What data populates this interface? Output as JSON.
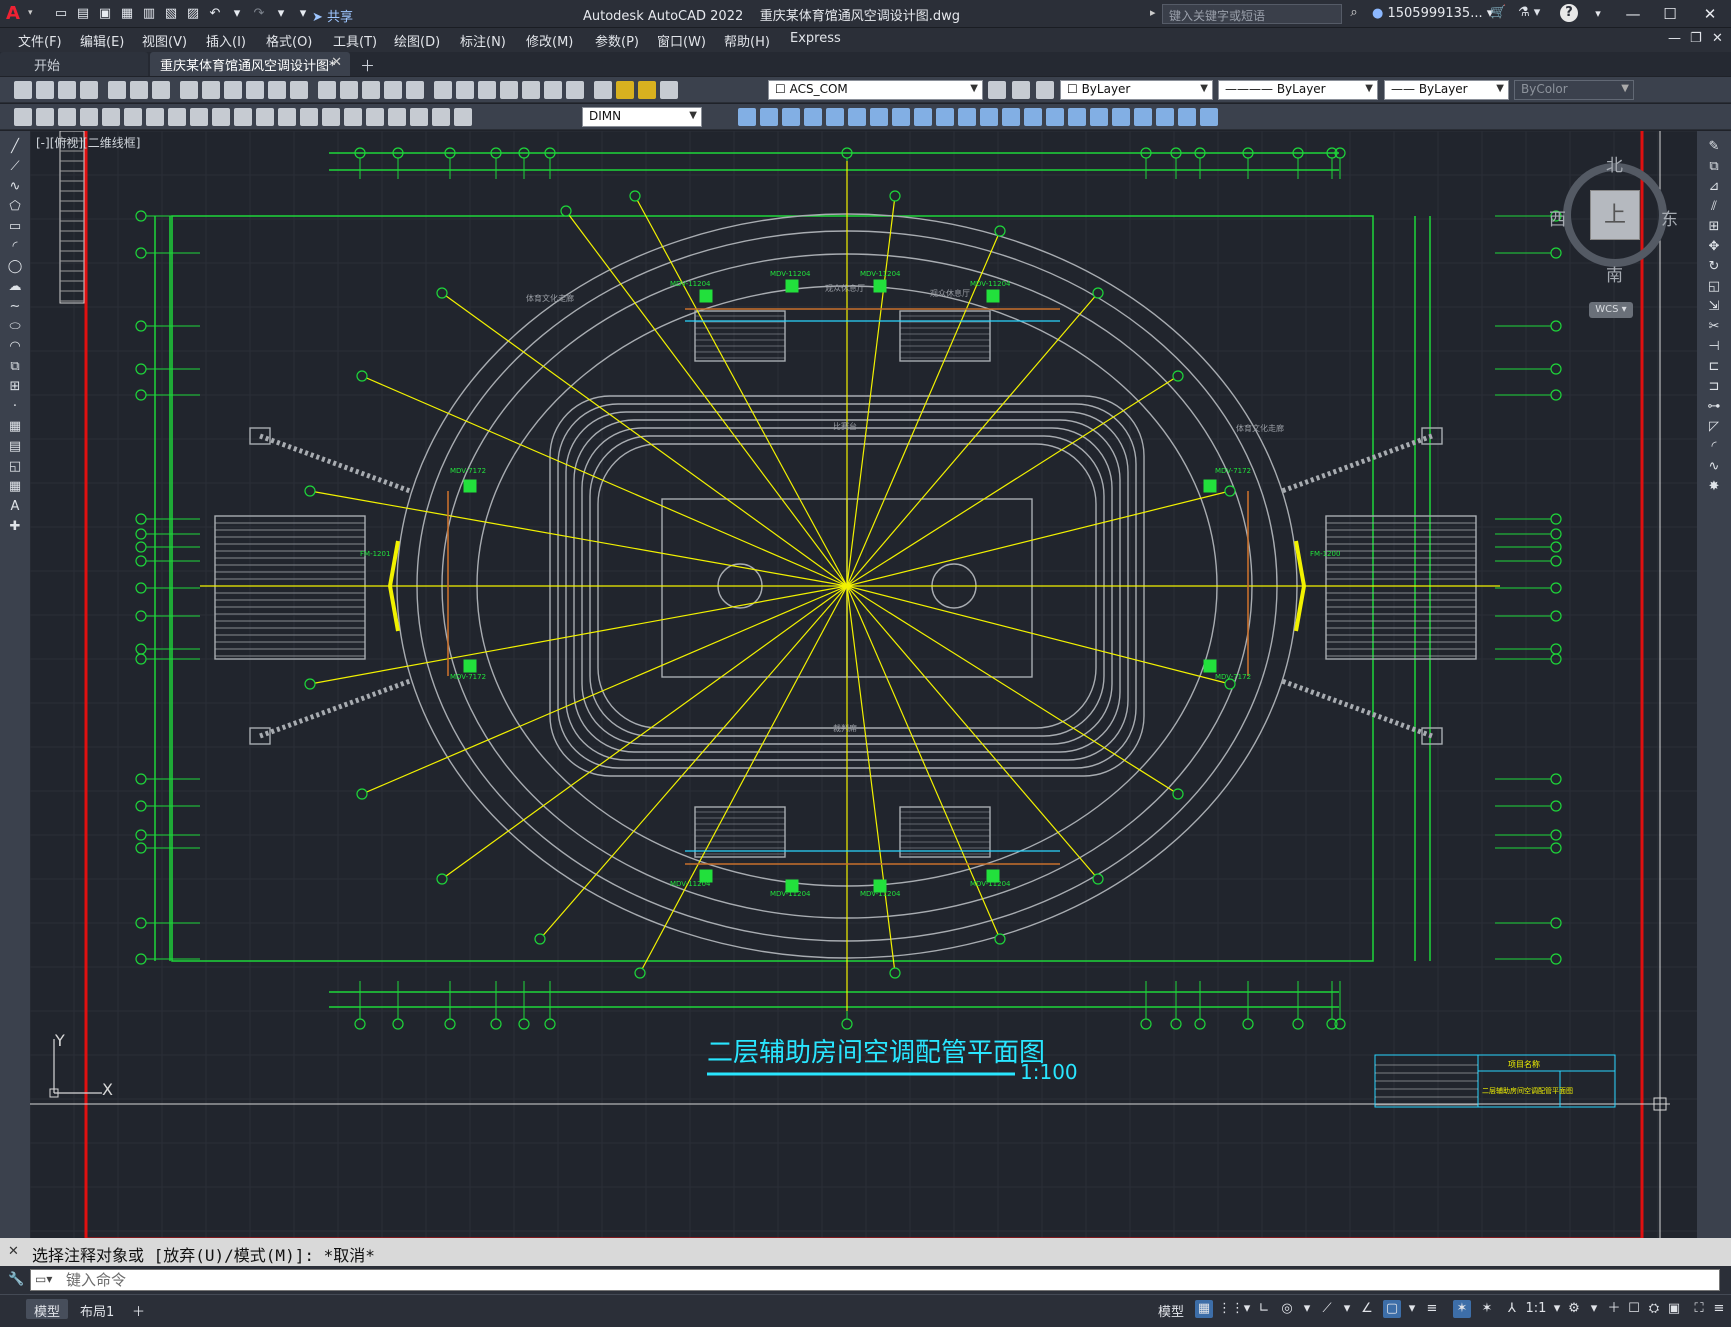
{
  "titlebar": {
    "app_name": "Autodesk AutoCAD 2022",
    "file_name": "重庆某体育馆通风空调设计图.dwg",
    "share_label": "共享",
    "search_placeholder": "键入关键字或短语",
    "user_name": "1505999135..."
  },
  "menu": [
    "文件(F)",
    "编辑(E)",
    "视图(V)",
    "插入(I)",
    "格式(O)",
    "工具(T)",
    "绘图(D)",
    "标注(N)",
    "修改(M)",
    "参数(P)",
    "窗口(W)",
    "帮助(H)",
    "Express"
  ],
  "tabs": {
    "start": "开始",
    "active": "重庆某体育馆通风空调设计图*"
  },
  "toolbar": {
    "text_style": "ACS_COM",
    "layer_color": "ByLayer",
    "linetype": "ByLayer",
    "lineweight": "ByLayer",
    "plot_style": "ByColor",
    "dim_style": "DIMN"
  },
  "viewport": {
    "label": "[-][俯视][二维线框]",
    "ucs_y": "Y",
    "ucs_x": "X",
    "drawing_title": "二层辅助房间空调配管平面图",
    "scale": "1:100",
    "tb_project": "项目名称",
    "tb_title": "二层辅助房间空调配管平面图",
    "hall_labels": [
      "观众休息厅",
      "观众休息厅",
      "体育文化走廊",
      "体育文化走廊",
      "比赛台",
      "裁判席"
    ],
    "equipment_labels": [
      "MDV-11204",
      "MDV-11204",
      "MDV-11204",
      "MDV-11204",
      "MDV-11204",
      "MDV-11204",
      "MDV-11204",
      "MDV-11204",
      "MDV-7172",
      "MDV-7172",
      "MDV-7172",
      "MDV-7172",
      "FM-1201",
      "FM-1200"
    ]
  },
  "viewcube": {
    "north": "北",
    "south": "南",
    "west": "西",
    "east": "东",
    "face": "上",
    "wcs": "WCS"
  },
  "command": {
    "history": "选择注释对象或 [放弃(U)/模式(M)]: *取消*",
    "placeholder": "键入命令"
  },
  "status": {
    "model_tab": "模型",
    "layout_tab": "布局1",
    "model_btn": "模型",
    "scale": "1:1"
  },
  "colors": {
    "grid_green": "#1ed63a",
    "axis_yellow": "#f2f200",
    "border_red": "#e01010",
    "title_cyan": "#29e6ff",
    "wall_gray": "#a8acb1"
  }
}
